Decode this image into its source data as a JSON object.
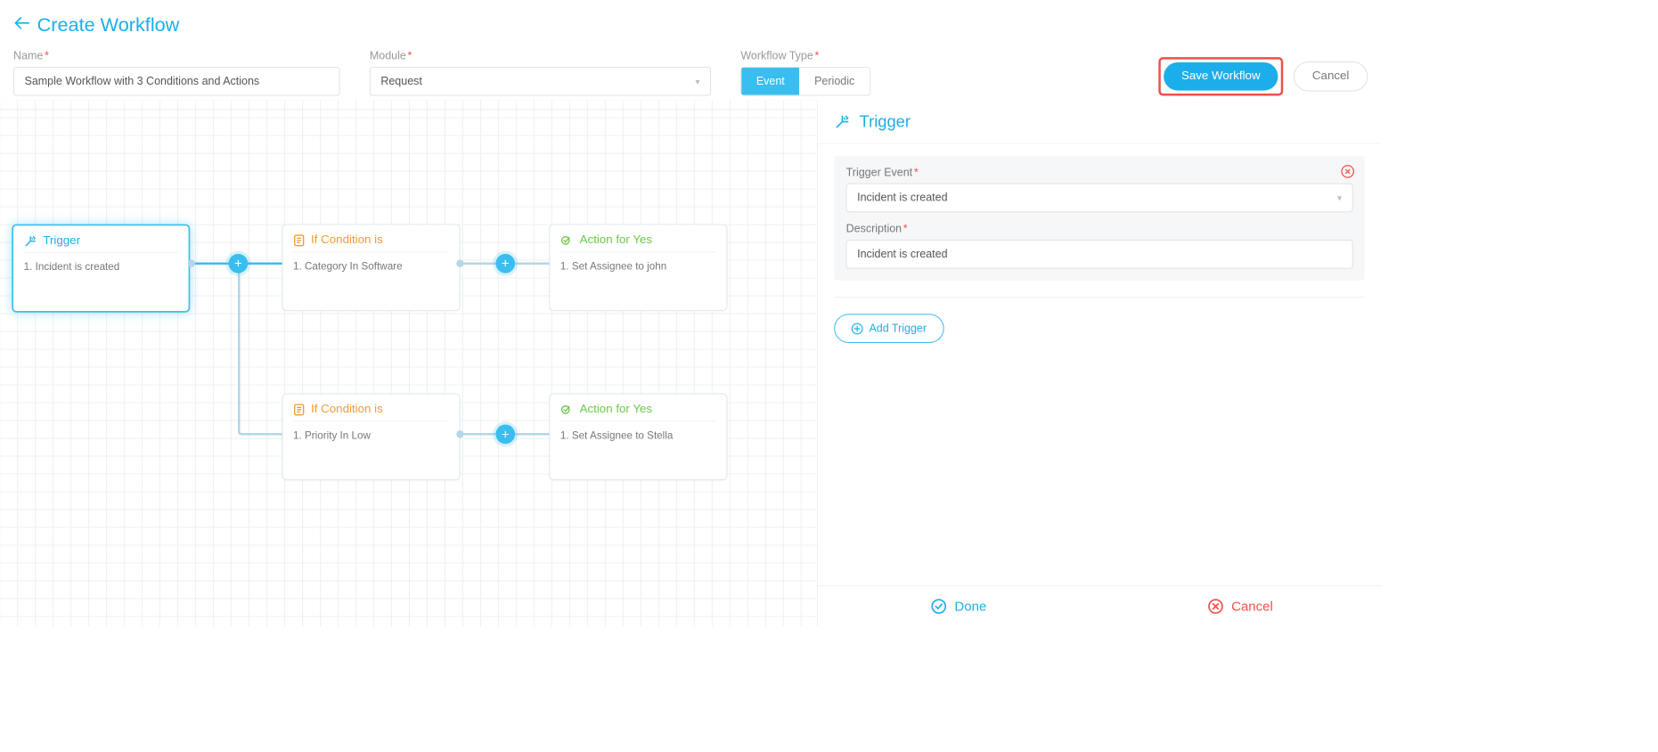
{
  "header": {
    "title": "Create Workflow",
    "name_label": "Name",
    "name_value": "Sample Workflow with 3 Conditions and Actions",
    "module_label": "Module",
    "module_value": "Request",
    "type_label": "Workflow Type",
    "type_event": "Event",
    "type_periodic": "Periodic",
    "save_label": "Save Workflow",
    "cancel_label": "Cancel"
  },
  "nodes": {
    "trigger": {
      "title": "Trigger",
      "item1": "1. Incident is created"
    },
    "cond1": {
      "title": "If Condition is",
      "item1": "1. Category In Software"
    },
    "act1": {
      "title": "Action for Yes",
      "item1": "1. Set Assignee to john"
    },
    "cond2": {
      "title": "If Condition is",
      "item1": "1. Priority In Low"
    },
    "act2": {
      "title": "Action for Yes",
      "item1": "1. Set Assignee to Stella"
    }
  },
  "panel": {
    "title": "Trigger",
    "event_label": "Trigger Event",
    "event_value": "Incident is created",
    "desc_label": "Description",
    "desc_value": "Incident is created",
    "add_label": "Add Trigger",
    "done_label": "Done",
    "cancel_label": "Cancel"
  }
}
